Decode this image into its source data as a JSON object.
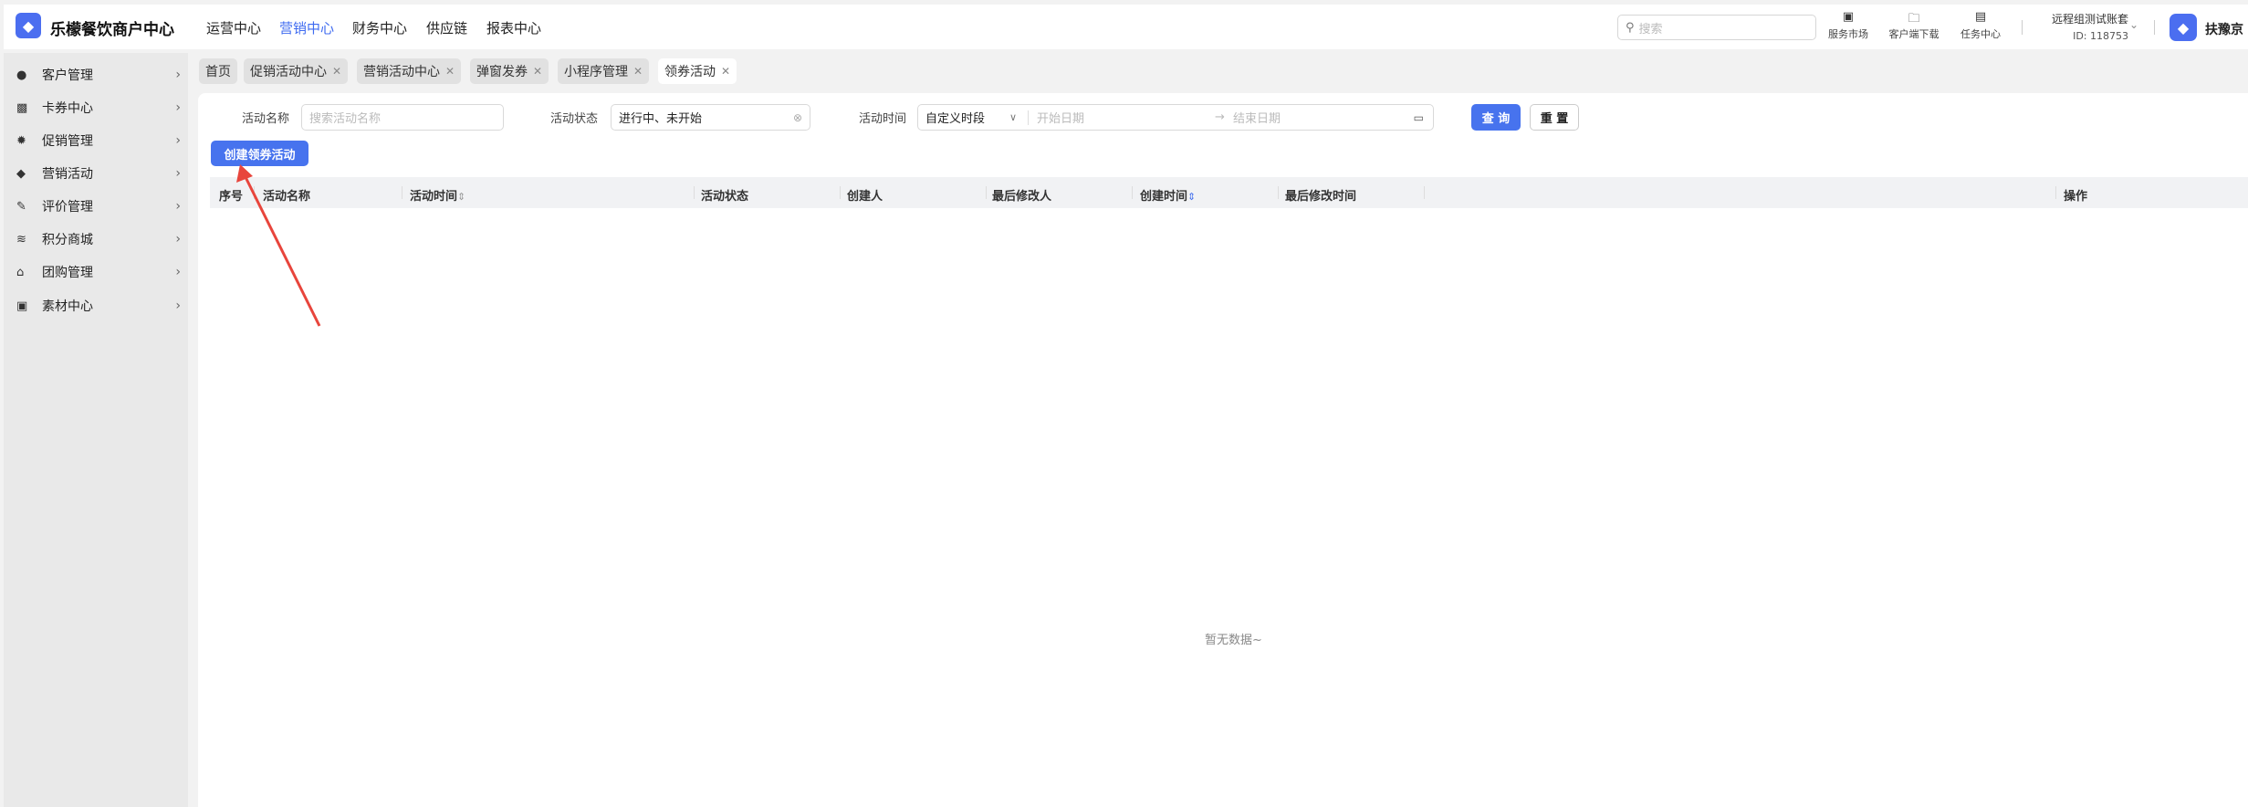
{
  "app": {
    "title": "乐檬餐饮商户中心",
    "logo_glyph": "⟋"
  },
  "nav": [
    "运营中心",
    "营销中心",
    "财务中心",
    "供应链",
    "报表中心"
  ],
  "nav_active": "营销中心",
  "search": {
    "placeholder": "搜索"
  },
  "tools": [
    {
      "label": "服务市场",
      "icon": "bag-icon"
    },
    {
      "label": "客户端下载",
      "icon": "folder-download-icon"
    },
    {
      "label": "任务中心",
      "icon": "clipboard-icon"
    }
  ],
  "account": {
    "name": "远程组测试账套",
    "id": "ID: 118753"
  },
  "user": {
    "name": "扶豫京"
  },
  "sidebar": [
    "客户管理",
    "卡券中心",
    "促销管理",
    "营销活动",
    "评价管理",
    "积分商城",
    "团购管理",
    "素材中心"
  ],
  "tabs": [
    "首页",
    "促销活动中心",
    "营销活动中心",
    "弹窗发券",
    "小程序管理",
    "领券活动"
  ],
  "filters": {
    "name_label": "活动名称",
    "name_placeholder": "搜索活动名称",
    "status_label": "活动状态",
    "status_value": "进行中、未开始",
    "time_label": "活动时间",
    "time_mode": "自定义时段",
    "start_placeholder": "开始日期",
    "end_placeholder": "结束日期",
    "query": "查 询",
    "reset": "重 置"
  },
  "create_button": "创建领券活动",
  "table": {
    "columns": [
      "序号",
      "活动名称",
      "活动时间",
      "活动状态",
      "创建人",
      "最后修改人",
      "创建时间",
      "最后修改时间",
      "操作"
    ],
    "empty": "暂无数据~"
  },
  "colors": {
    "accent": "#4773ee",
    "arrow": "#e8453c"
  }
}
